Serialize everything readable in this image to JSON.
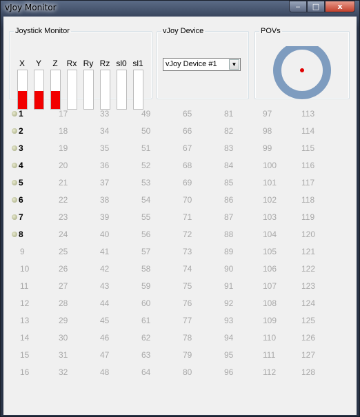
{
  "window": {
    "title": "vJoy Monitor",
    "min_glyph": "‒",
    "max_glyph": "□",
    "close_glyph": "x"
  },
  "joystick_monitor": {
    "legend": "Joystick Monitor",
    "axes": [
      {
        "label": "X",
        "level": 0.47
      },
      {
        "label": "Y",
        "level": 0.47
      },
      {
        "label": "Z",
        "level": 0.47
      },
      {
        "label": "Rx",
        "level": 0
      },
      {
        "label": "Ry",
        "level": 0
      },
      {
        "label": "Rz",
        "level": 0
      },
      {
        "label": "sl0",
        "level": 0
      },
      {
        "label": "sl1",
        "level": 0
      }
    ],
    "fill_color": "#f20000"
  },
  "vjoy_device": {
    "legend": "vJoy Device",
    "selected": "vJoy Device #1",
    "arrow": "▼"
  },
  "povs": {
    "legend": "POVs",
    "ring_color": "#7e9cbf",
    "dot_color": "#e00000"
  },
  "buttons": {
    "columns": [
      [
        "1",
        "2",
        "3",
        "4",
        "5",
        "6",
        "7",
        "8",
        "9",
        "10",
        "11",
        "12",
        "13",
        "14",
        "15",
        "16"
      ],
      [
        "17",
        "18",
        "19",
        "20",
        "21",
        "22",
        "23",
        "24",
        "25",
        "26",
        "27",
        "28",
        "29",
        "30",
        "31",
        "32"
      ],
      [
        "33",
        "34",
        "35",
        "36",
        "37",
        "38",
        "39",
        "40",
        "41",
        "42",
        "43",
        "44",
        "45",
        "46",
        "47",
        "48"
      ],
      [
        "49",
        "50",
        "51",
        "52",
        "53",
        "54",
        "55",
        "56",
        "57",
        "58",
        "59",
        "60",
        "61",
        "62",
        "63",
        "64"
      ],
      [
        "65",
        "66",
        "67",
        "68",
        "69",
        "70",
        "71",
        "72",
        "73",
        "74",
        "75",
        "76",
        "77",
        "78",
        "79",
        "80"
      ],
      [
        "81",
        "82",
        "83",
        "84",
        "85",
        "86",
        "87",
        "88",
        "89",
        "90",
        "91",
        "92",
        "93",
        "94",
        "95",
        "96"
      ],
      [
        "97",
        "98",
        "99",
        "100",
        "101",
        "102",
        "103",
        "104",
        "105",
        "106",
        "107",
        "108",
        "109",
        "110",
        "111",
        "112"
      ],
      [
        "113",
        "114",
        "115",
        "116",
        "117",
        "118",
        "119",
        "120",
        "121",
        "122",
        "123",
        "124",
        "125",
        "126",
        "127",
        "128"
      ]
    ],
    "active": [
      "1",
      "2",
      "3",
      "4",
      "5",
      "6",
      "7",
      "8"
    ]
  }
}
